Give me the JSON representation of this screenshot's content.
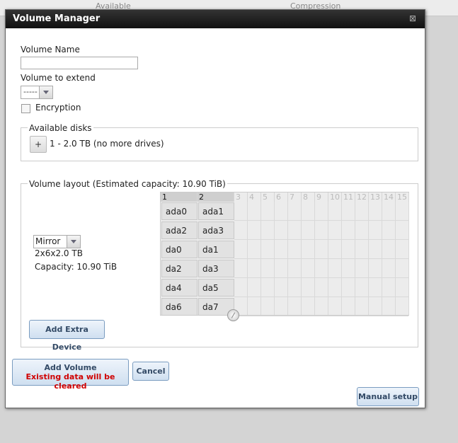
{
  "background": {
    "col1": "Available",
    "col2": "Compression"
  },
  "dialog": {
    "title": "Volume Manager",
    "close_glyph": "⊠"
  },
  "form": {
    "volume_name_label": "Volume Name",
    "volume_name_value": "",
    "extend_label": "Volume to extend",
    "extend_value": "-----",
    "encryption_label": "Encryption",
    "encryption_checked": false
  },
  "available_disks": {
    "legend": "Available disks",
    "plus_label": "+",
    "summary": "1 - 2.0 TB (no more drives)"
  },
  "volume_layout": {
    "legend": "Volume layout (Estimated capacity: 10.90 TiB)",
    "layout_type": "Mirror",
    "geometry": "2x6x2.0 TB",
    "capacity": "Capacity: 10.90 TiB",
    "column_headers": [
      "1",
      "2",
      "3",
      "4",
      "5",
      "6",
      "7",
      "8",
      "9",
      "10",
      "11",
      "12",
      "13",
      "14",
      "15"
    ],
    "rows": [
      [
        "ada0",
        "ada1"
      ],
      [
        "ada2",
        "ada3"
      ],
      [
        "da0",
        "da1"
      ],
      [
        "da2",
        "da3"
      ],
      [
        "da4",
        "da5"
      ],
      [
        "da6",
        "da7"
      ]
    ],
    "add_extra_device_label": "Add Extra Device"
  },
  "buttons": {
    "add_volume_label": "Add Volume",
    "add_volume_warning": "Existing data will be cleared",
    "cancel_label": "Cancel",
    "manual_setup_label": "Manual setup"
  },
  "colors": {
    "warning": "#d00000",
    "button_border": "#7a9cc0",
    "titlebar": "#1a1a1a"
  }
}
